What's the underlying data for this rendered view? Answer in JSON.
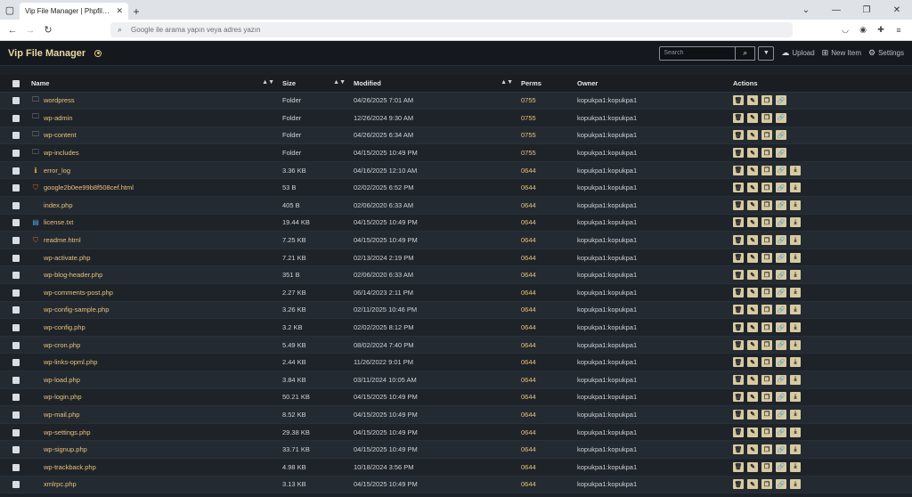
{
  "browser": {
    "tab_title": "Vip File Manager | Phpfilemanager.c",
    "address_placeholder": "Google ile arama yapın veya adres yazın"
  },
  "app": {
    "title": "Vip File Manager",
    "search_placeholder": "Search",
    "upload_label": "Upload",
    "new_item_label": "New Item",
    "settings_label": "Settings"
  },
  "table": {
    "headers": {
      "name": "Name",
      "size": "Size",
      "modified": "Modified",
      "perms": "Perms",
      "owner": "Owner",
      "actions": "Actions"
    },
    "rows": [
      {
        "type": "folder",
        "name": "wordpress",
        "size": "Folder",
        "modified": "04/26/2025 7:01 AM",
        "perms": "0755",
        "owner": "kopukpa1:kopukpa1"
      },
      {
        "type": "folder",
        "name": "wp-admin",
        "size": "Folder",
        "modified": "12/26/2024 9:30 AM",
        "perms": "0755",
        "owner": "kopukpa1:kopukpa1"
      },
      {
        "type": "folder",
        "name": "wp-content",
        "size": "Folder",
        "modified": "04/26/2025 6:34 AM",
        "perms": "0755",
        "owner": "kopukpa1:kopukpa1"
      },
      {
        "type": "folder",
        "name": "wp-includes",
        "size": "Folder",
        "modified": "04/15/2025 10:49 PM",
        "perms": "0755",
        "owner": "kopukpa1:kopukpa1"
      },
      {
        "type": "info",
        "name": "error_log",
        "size": "3.36 KB",
        "modified": "04/16/2025 12:10 AM",
        "perms": "0644",
        "owner": "kopukpa1:kopukpa1"
      },
      {
        "type": "html",
        "name": "google2b0ee99b8f508cef.html",
        "size": "53 B",
        "modified": "02/02/2025 6:52 PM",
        "perms": "0644",
        "owner": "kopukpa1:kopukpa1"
      },
      {
        "type": "php",
        "name": "index.php",
        "size": "405 B",
        "modified": "02/06/2020 6:33 AM",
        "perms": "0644",
        "owner": "kopukpa1:kopukpa1"
      },
      {
        "type": "txt",
        "name": "license.txt",
        "size": "19.44 KB",
        "modified": "04/15/2025 10:49 PM",
        "perms": "0644",
        "owner": "kopukpa1:kopukpa1"
      },
      {
        "type": "html",
        "name": "readme.html",
        "size": "7.25 KB",
        "modified": "04/15/2025 10:49 PM",
        "perms": "0644",
        "owner": "kopukpa1:kopukpa1"
      },
      {
        "type": "php",
        "name": "wp-activate.php",
        "size": "7.21 KB",
        "modified": "02/13/2024 2:19 PM",
        "perms": "0644",
        "owner": "kopukpa1:kopukpa1"
      },
      {
        "type": "php",
        "name": "wp-blog-header.php",
        "size": "351 B",
        "modified": "02/06/2020 6:33 AM",
        "perms": "0644",
        "owner": "kopukpa1:kopukpa1"
      },
      {
        "type": "php",
        "name": "wp-comments-post.php",
        "size": "2.27 KB",
        "modified": "06/14/2023 2:11 PM",
        "perms": "0644",
        "owner": "kopukpa1:kopukpa1"
      },
      {
        "type": "php",
        "name": "wp-config-sample.php",
        "size": "3.26 KB",
        "modified": "02/11/2025 10:46 PM",
        "perms": "0644",
        "owner": "kopukpa1:kopukpa1"
      },
      {
        "type": "php",
        "name": "wp-config.php",
        "size": "3.2 KB",
        "modified": "02/02/2025 8:12 PM",
        "perms": "0644",
        "owner": "kopukpa1:kopukpa1"
      },
      {
        "type": "php",
        "name": "wp-cron.php",
        "size": "5.49 KB",
        "modified": "08/02/2024 7:40 PM",
        "perms": "0644",
        "owner": "kopukpa1:kopukpa1"
      },
      {
        "type": "php",
        "name": "wp-links-opml.php",
        "size": "2.44 KB",
        "modified": "11/26/2022 9:01 PM",
        "perms": "0644",
        "owner": "kopukpa1:kopukpa1"
      },
      {
        "type": "php",
        "name": "wp-load.php",
        "size": "3.84 KB",
        "modified": "03/11/2024 10:05 AM",
        "perms": "0644",
        "owner": "kopukpa1:kopukpa1"
      },
      {
        "type": "php",
        "name": "wp-login.php",
        "size": "50.21 KB",
        "modified": "04/15/2025 10:49 PM",
        "perms": "0644",
        "owner": "kopukpa1:kopukpa1"
      },
      {
        "type": "php",
        "name": "wp-mail.php",
        "size": "8.52 KB",
        "modified": "04/15/2025 10:49 PM",
        "perms": "0644",
        "owner": "kopukpa1:kopukpa1"
      },
      {
        "type": "php",
        "name": "wp-settings.php",
        "size": "29.38 KB",
        "modified": "04/15/2025 10:49 PM",
        "perms": "0644",
        "owner": "kopukpa1:kopukpa1"
      },
      {
        "type": "php",
        "name": "wp-signup.php",
        "size": "33.71 KB",
        "modified": "04/15/2025 10:49 PM",
        "perms": "0644",
        "owner": "kopukpa1:kopukpa1"
      },
      {
        "type": "php",
        "name": "wp-trackback.php",
        "size": "4.98 KB",
        "modified": "10/18/2024 3:56 PM",
        "perms": "0644",
        "owner": "kopukpa1:kopukpa1"
      },
      {
        "type": "php",
        "name": "xmlrpc.php",
        "size": "3.13 KB",
        "modified": "04/15/2025 10:49 PM",
        "perms": "0644",
        "owner": "kopukpa1:kopukpa1"
      }
    ]
  },
  "colors": {
    "accent": "#e8c27a",
    "header_bg": "#15191d",
    "row_odd": "#242a31",
    "row_even": "#1e2329",
    "action_btn": "#d8caa0"
  }
}
